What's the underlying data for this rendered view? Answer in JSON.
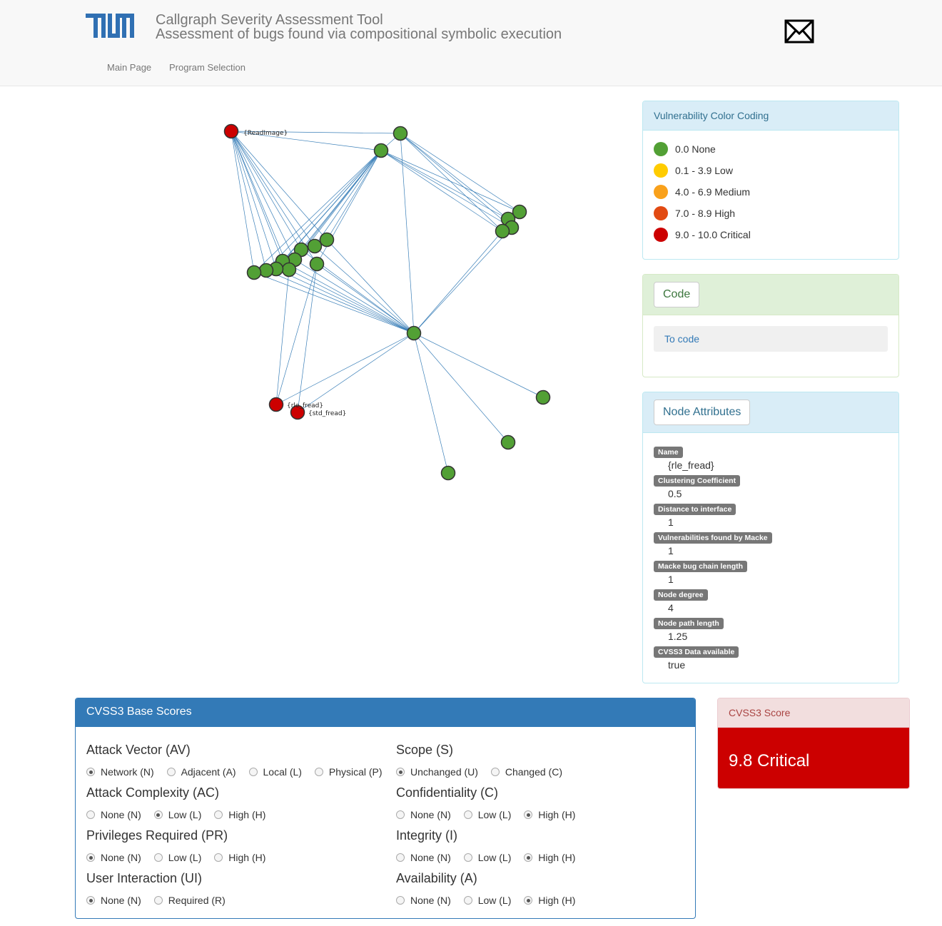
{
  "header": {
    "title": "Callgraph Severity Assessment Tool",
    "subtitle": "Assessment of bugs found via compositional symbolic execution",
    "logo_color": "#3070b3",
    "mail_icon": "envelope-icon"
  },
  "nav": {
    "main_page": "Main Page",
    "program_selection": "Program Selection"
  },
  "graph": {
    "labels": {
      "readimage": "{ReadImage}",
      "rle_fread": "{rle_fread}",
      "std_fread": "{std_fread}"
    },
    "node_colors": {
      "none": "#52a035",
      "critical": "#cc0000"
    },
    "edge_color": "#3a7fb8"
  },
  "color_coding": {
    "title": "Vulnerability Color Coding",
    "items": [
      {
        "label": "0.0 None",
        "color": "#52a035"
      },
      {
        "label": "0.1 - 3.9 Low",
        "color": "#ffcc00"
      },
      {
        "label": "4.0 - 6.9 Medium",
        "color": "#f9a11b"
      },
      {
        "label": "7.0 - 8.9 High",
        "color": "#e24a12"
      },
      {
        "label": "9.0 - 10.0 Critical",
        "color": "#cc0000"
      }
    ]
  },
  "code_panel": {
    "button": "Code",
    "link": "To code"
  },
  "node_attributes": {
    "button": "Node Attributes",
    "items": [
      {
        "label": "Name",
        "value": "{rle_fread}"
      },
      {
        "label": "Clustering Coefficient",
        "value": "0.5"
      },
      {
        "label": "Distance to interface",
        "value": "1"
      },
      {
        "label": "Vulnerabilities found by Macke",
        "value": "1"
      },
      {
        "label": "Macke bug chain length",
        "value": "1"
      },
      {
        "label": "Node degree",
        "value": "4"
      },
      {
        "label": "Node path length",
        "value": "1.25"
      },
      {
        "label": "CVSS3 Data available",
        "value": "true"
      }
    ]
  },
  "cvss_base": {
    "title": "CVSS3 Base Scores",
    "left": [
      {
        "title": "Attack Vector (AV)",
        "options": [
          "Network (N)",
          "Adjacent (A)",
          "Local (L)",
          "Physical (P)"
        ],
        "selected": 0
      },
      {
        "title": "Attack Complexity (AC)",
        "options": [
          "None (N)",
          "Low (L)",
          "High (H)"
        ],
        "selected": 1
      },
      {
        "title": "Privileges Required (PR)",
        "options": [
          "None (N)",
          "Low (L)",
          "High (H)"
        ],
        "selected": 0
      },
      {
        "title": "User Interaction (UI)",
        "options": [
          "None (N)",
          "Required (R)"
        ],
        "selected": 0
      }
    ],
    "right": [
      {
        "title": "Scope (S)",
        "options": [
          "Unchanged (U)",
          "Changed (C)"
        ],
        "selected": 0
      },
      {
        "title": "Confidentiality (C)",
        "options": [
          "None (N)",
          "Low (L)",
          "High (H)"
        ],
        "selected": 2
      },
      {
        "title": "Integrity (I)",
        "options": [
          "None (N)",
          "Low (L)",
          "High (H)"
        ],
        "selected": 2
      },
      {
        "title": "Availability (A)",
        "options": [
          "None (N)",
          "Low (L)",
          "High (H)"
        ],
        "selected": 2
      }
    ]
  },
  "cvss_score": {
    "title": "CVSS3 Score",
    "value": "9.8 Critical",
    "color": "#cc0000"
  }
}
